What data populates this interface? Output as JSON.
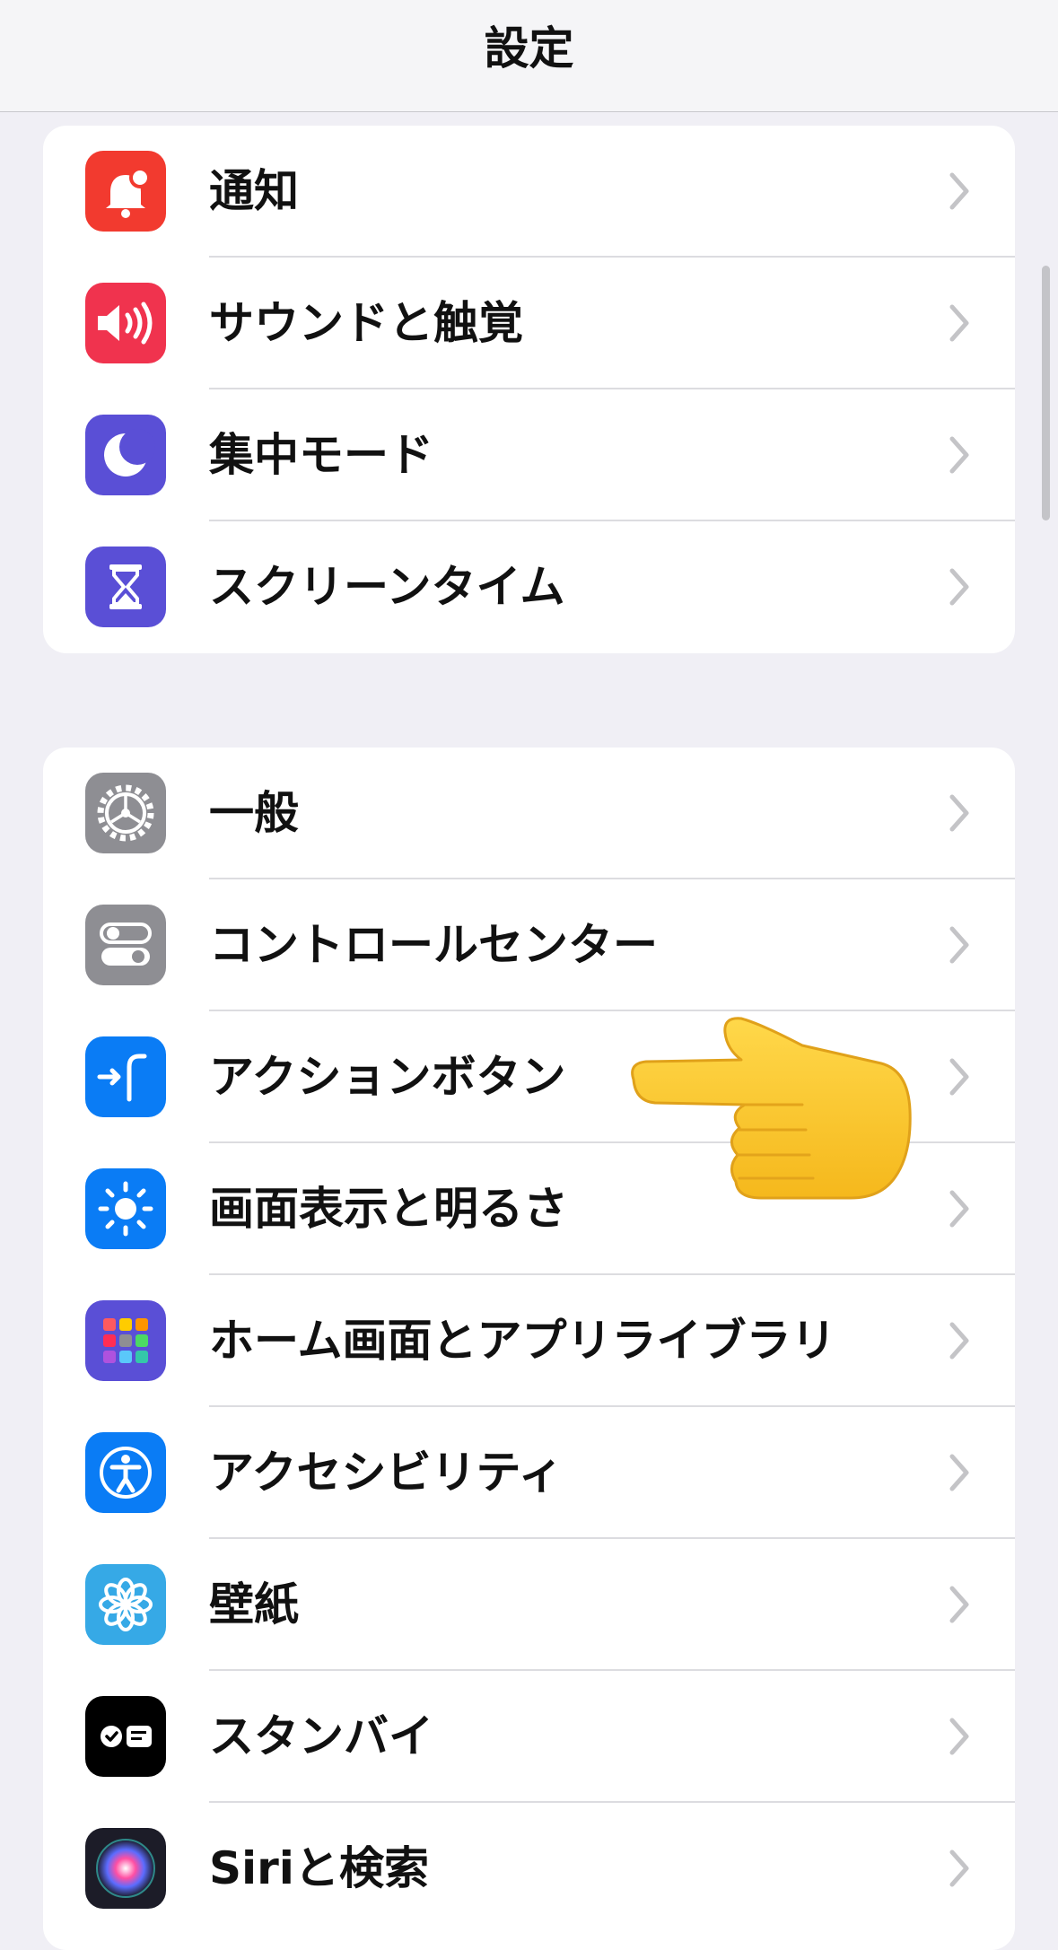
{
  "navbar": {
    "title": "設定"
  },
  "groups": [
    {
      "items": [
        {
          "label": "通知",
          "icon": "notifications-icon",
          "color": "#f23a2f"
        },
        {
          "label": "サウンドと触覚",
          "icon": "speaker-icon",
          "color": "#f0334e"
        },
        {
          "label": "集中モード",
          "icon": "moon-icon",
          "color": "#5a4fd6"
        },
        {
          "label": "スクリーンタイム",
          "icon": "hourglass-icon",
          "color": "#5a4fd6"
        }
      ]
    },
    {
      "items": [
        {
          "label": "一般",
          "icon": "gear-icon",
          "color": "#8e8e93"
        },
        {
          "label": "コントロールセンター",
          "icon": "toggles-icon",
          "color": "#8e8e93"
        },
        {
          "label": "アクションボタン",
          "icon": "action-button-icon",
          "color": "#0a7cf5"
        },
        {
          "label": "画面表示と明るさ",
          "icon": "sun-icon",
          "color": "#0a7cf5"
        },
        {
          "label": "ホーム画面とアプリライブラリ",
          "icon": "app-grid-icon",
          "color": "#5a4fd6"
        },
        {
          "label": "アクセシビリティ",
          "icon": "accessibility-icon",
          "color": "#0a7cf5"
        },
        {
          "label": "壁紙",
          "icon": "flower-icon",
          "color": "#36a9e6"
        },
        {
          "label": "スタンバイ",
          "icon": "standby-icon",
          "color": "#000000"
        },
        {
          "label": "Siriと検索",
          "icon": "siri-icon",
          "color": "#1c1c28"
        }
      ]
    }
  ],
  "overlay": {
    "icon": "pointing-hand-icon"
  }
}
